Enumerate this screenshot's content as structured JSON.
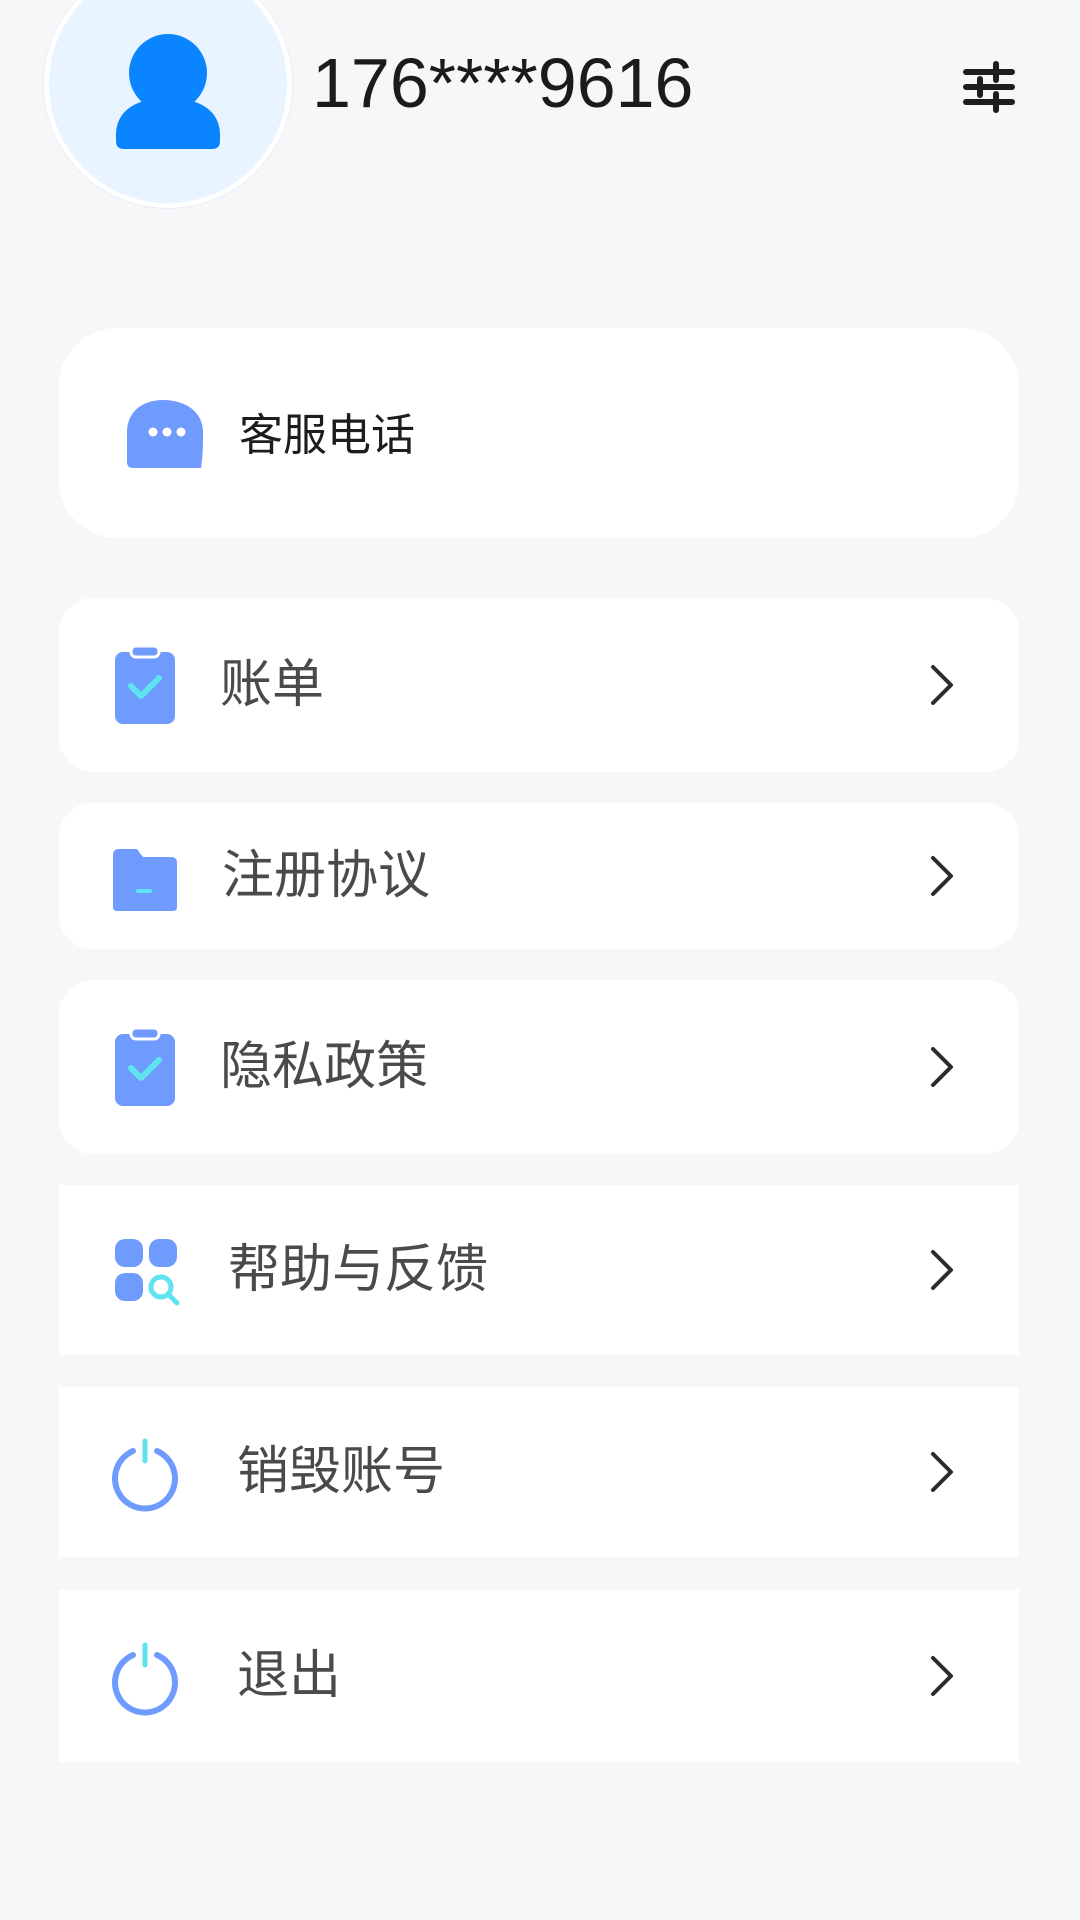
{
  "profile": {
    "phone": "176****9616",
    "avatar_icon": "user-icon",
    "settings_icon": "sliders-icon"
  },
  "customer_service": {
    "label": "客服电话",
    "icon": "chat-bubble-icon"
  },
  "menu": [
    {
      "label": "账单",
      "icon": "clipboard-check-icon"
    },
    {
      "label": "注册协议",
      "icon": "folder-icon"
    },
    {
      "label": "隐私政策",
      "icon": "clipboard-check-icon"
    },
    {
      "label": "帮助与反馈",
      "icon": "grid-search-icon"
    },
    {
      "label": "销毁账号",
      "icon": "power-icon"
    },
    {
      "label": "退出",
      "icon": "power-icon"
    }
  ],
  "colors": {
    "accent_blue": "#0a84ff",
    "icon_blue": "#6f9bff",
    "icon_check": "#5fe3ef",
    "background": "#f6f7f9",
    "card": "#ffffff"
  }
}
